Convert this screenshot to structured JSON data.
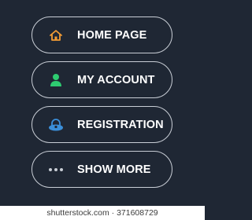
{
  "colors": {
    "background": "#1f2734",
    "border": "#c9ced6",
    "text": "#ffffff",
    "home_icon": "#f39c34",
    "account_icon": "#2ecc71",
    "registration_icon": "#3b8fd9",
    "more_icon": "#c9ced6"
  },
  "menu": {
    "items": [
      {
        "label": "HOME PAGE",
        "icon": "home-icon"
      },
      {
        "label": "MY ACCOUNT",
        "icon": "user-icon"
      },
      {
        "label": "REGISTRATION",
        "icon": "lock-icon"
      },
      {
        "label": "SHOW MORE",
        "icon": "more-dots-icon"
      }
    ]
  },
  "watermark": "shutterstock.com · 371608729"
}
